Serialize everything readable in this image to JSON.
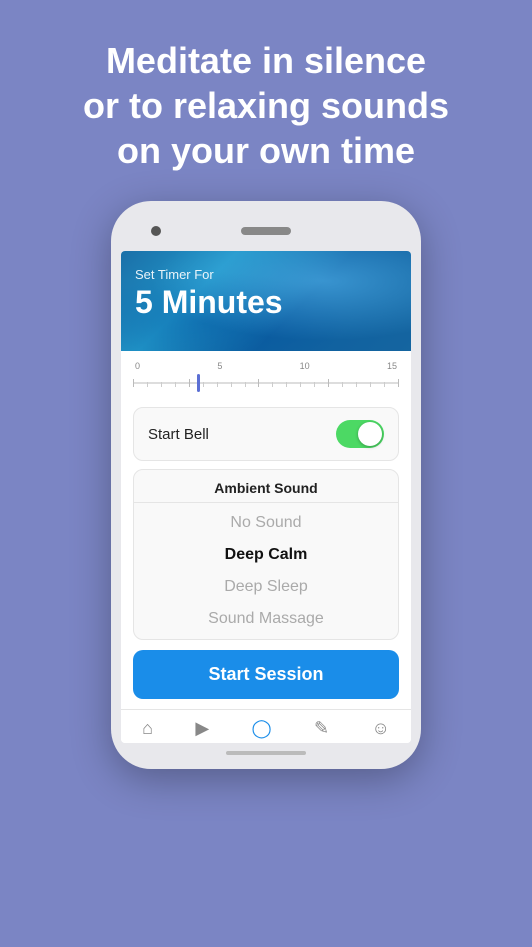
{
  "headline": {
    "line1": "Meditate in silence",
    "line2": "or to relaxing sounds",
    "line3": "on your own time",
    "full": "Meditate in silence\nor to relaxing sounds\non your own time"
  },
  "app": {
    "timer": {
      "label": "Set Timer For",
      "value": "5 Minutes",
      "slider_min": 0,
      "slider_max": 20,
      "slider_current": 5,
      "marks": [
        "0",
        "5",
        "10",
        "15"
      ]
    },
    "bell": {
      "label": "Start Bell",
      "enabled": true
    },
    "ambient": {
      "title": "Ambient Sound",
      "options": [
        {
          "label": "No Sound",
          "state": "muted"
        },
        {
          "label": "Deep Calm",
          "state": "selected"
        },
        {
          "label": "Deep Sleep",
          "state": "muted"
        },
        {
          "label": "Sound Massage",
          "state": "muted"
        }
      ]
    },
    "start_button": {
      "label": "Start Session"
    },
    "nav": {
      "items": [
        {
          "icon": "home",
          "symbol": "⌂",
          "active": false
        },
        {
          "icon": "play",
          "symbol": "▶",
          "active": false
        },
        {
          "icon": "timer",
          "symbol": "◉",
          "active": true
        },
        {
          "icon": "edit",
          "symbol": "✎",
          "active": false
        },
        {
          "icon": "person",
          "symbol": "♟",
          "active": false
        }
      ]
    }
  }
}
